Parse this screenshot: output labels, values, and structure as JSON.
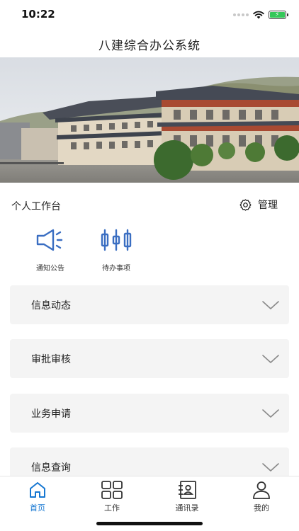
{
  "status_bar": {
    "time": "10:22"
  },
  "header": {
    "title": "八建综合办公系统"
  },
  "workbench": {
    "title": "个人工作台",
    "manage_label": "管理",
    "shortcuts": [
      {
        "label": "通知公告",
        "icon": "megaphone-icon"
      },
      {
        "label": "待办事项",
        "icon": "todo-icon"
      }
    ]
  },
  "sections": [
    {
      "label": "信息动态"
    },
    {
      "label": "审批审核"
    },
    {
      "label": "业务申请"
    },
    {
      "label": "信息查询"
    }
  ],
  "tab_bar": {
    "tabs": [
      {
        "label": "首页",
        "icon": "home-icon",
        "active": true
      },
      {
        "label": "工作",
        "icon": "grid-icon",
        "active": false
      },
      {
        "label": "通讯录",
        "icon": "contacts-icon",
        "active": false
      },
      {
        "label": "我的",
        "icon": "user-icon",
        "active": false
      }
    ]
  },
  "colors": {
    "accent": "#1677d2",
    "icon_blue": "#3a6ec2",
    "section_bg": "#f4f4f4"
  }
}
